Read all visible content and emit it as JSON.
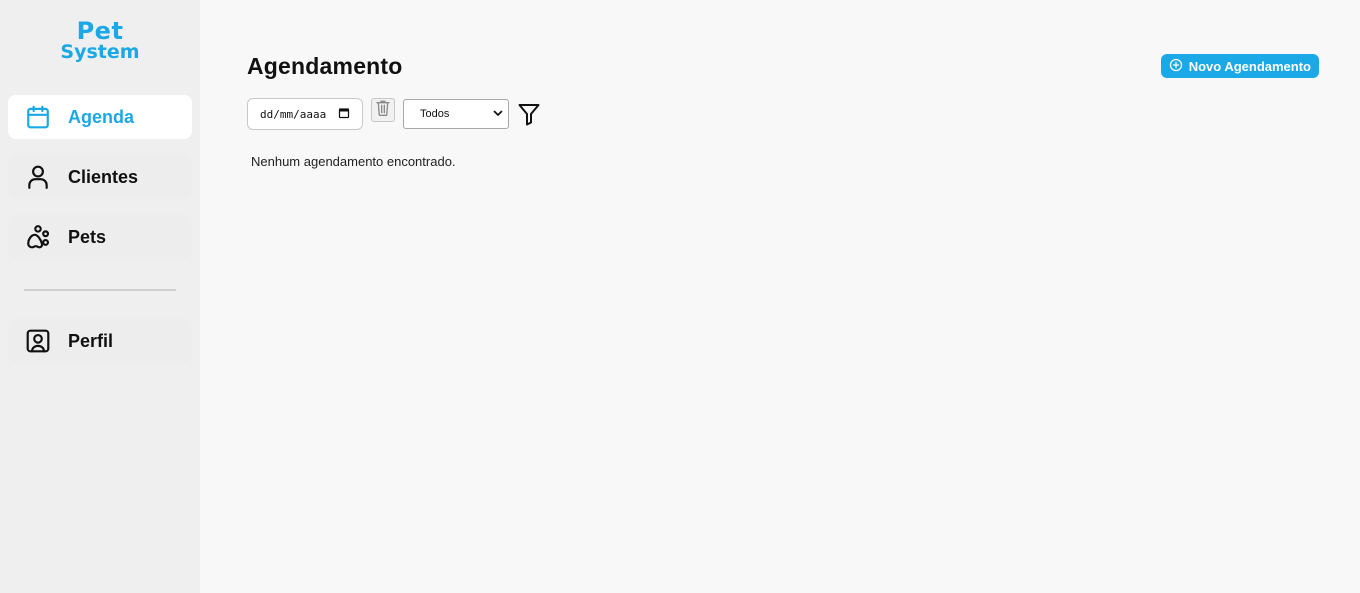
{
  "logo": {
    "line1": "Pet",
    "line2": "System"
  },
  "sidebar": {
    "items": [
      {
        "label": "Agenda",
        "icon": "calendar-icon",
        "active": true
      },
      {
        "label": "Clientes",
        "icon": "user-icon",
        "active": false
      },
      {
        "label": "Pets",
        "icon": "paw-icon",
        "active": false
      },
      {
        "label": "Perfil",
        "icon": "profile-icon",
        "active": false
      }
    ]
  },
  "main": {
    "title": "Agendamento",
    "new_button_label": "Novo Agendamento",
    "filters": {
      "date_placeholder": "dd/mm/aaaa",
      "select_value": "Todos"
    },
    "empty_message": "Nenhum agendamento encontrado."
  },
  "colors": {
    "accent": "#1ba8e6",
    "sidebar_bg": "#efefef",
    "main_bg": "#f8f8f8"
  }
}
